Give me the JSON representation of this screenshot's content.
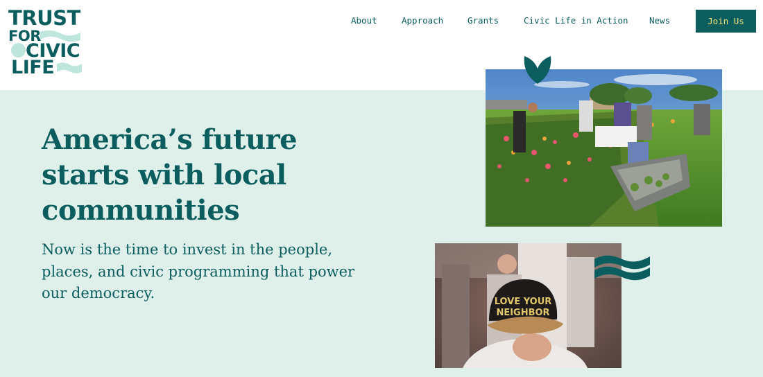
{
  "brand": {
    "logo_lines": [
      "TRUST",
      "FOR",
      "CIVIC",
      "LIFE"
    ],
    "colors": {
      "primary": "#0b5d5e",
      "accent_text": "#f4e27a",
      "hero_bg": "#dff0eb",
      "light_mint": "#bfe6dc"
    }
  },
  "nav": {
    "items": [
      "About",
      "Approach",
      "Grants",
      "Civic Life in Action",
      "News"
    ],
    "cta": "Join Us"
  },
  "hero": {
    "headline": "America’s future starts with local communities",
    "subtext": "Now is the time to invest in the people, places, and civic programming that power our democracy."
  },
  "photos": {
    "hat_text": [
      "LOVE YOUR",
      "NEIGHBOR"
    ]
  },
  "icons": [
    "leaf-icon",
    "wave-icon"
  ]
}
